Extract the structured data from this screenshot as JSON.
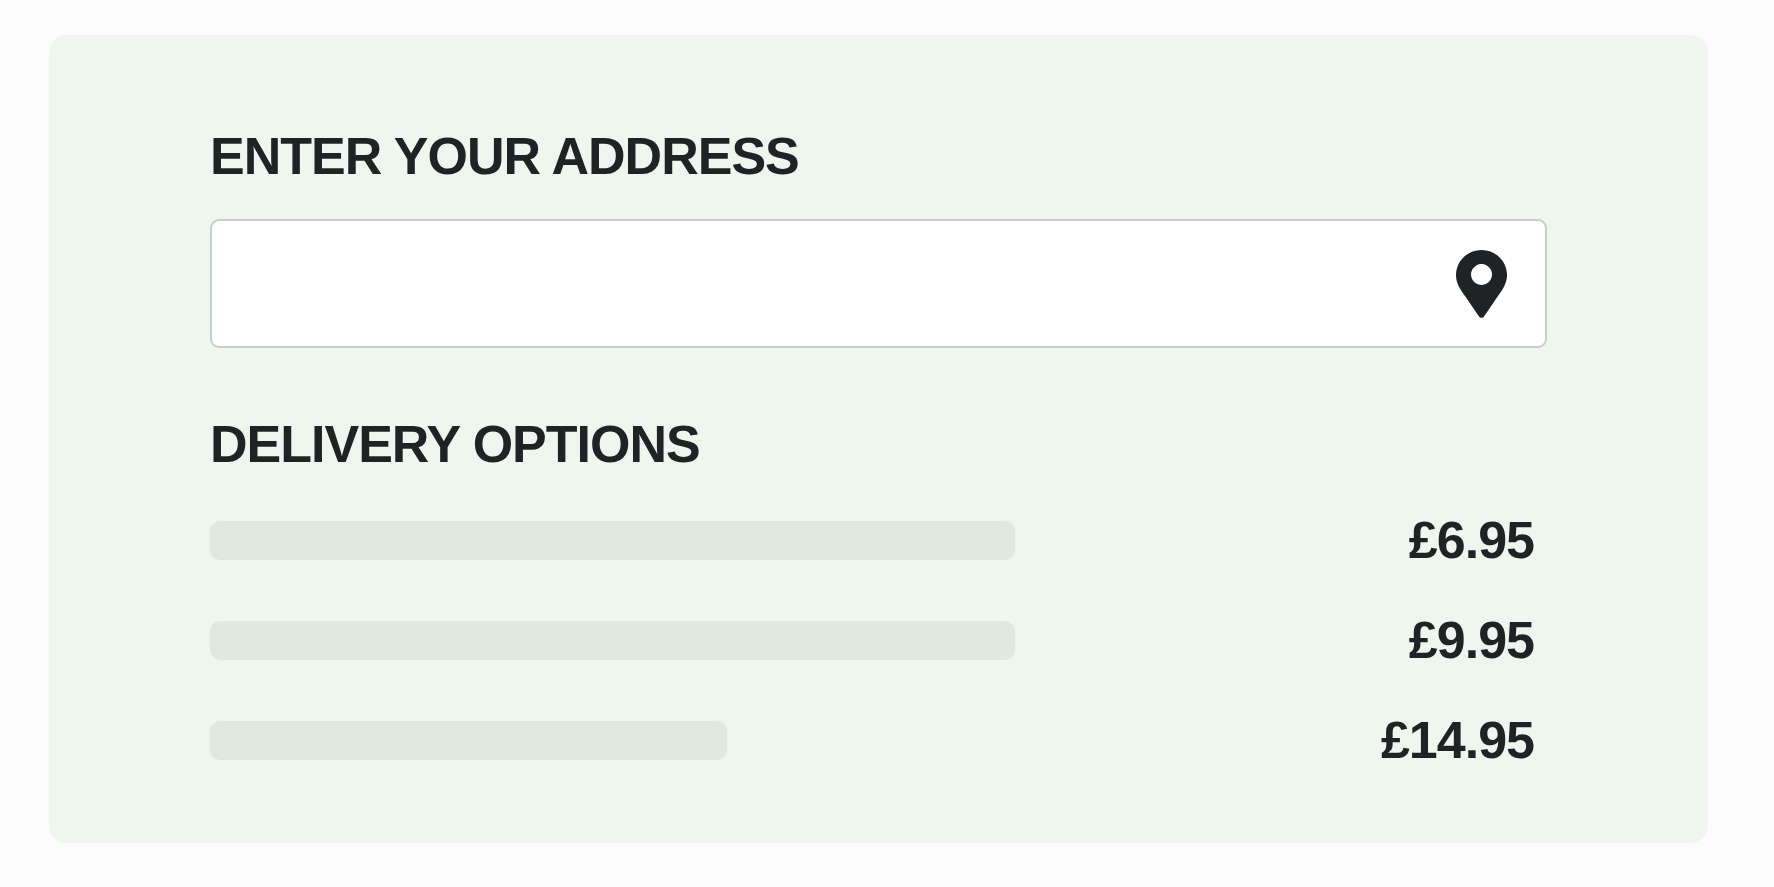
{
  "address": {
    "title": "ENTER YOUR ADDRESS"
  },
  "delivery": {
    "title": "DELIVERY OPTIONS",
    "options": [
      {
        "price": "£6.95"
      },
      {
        "price": "£9.95"
      },
      {
        "price": "£14.95"
      }
    ]
  }
}
